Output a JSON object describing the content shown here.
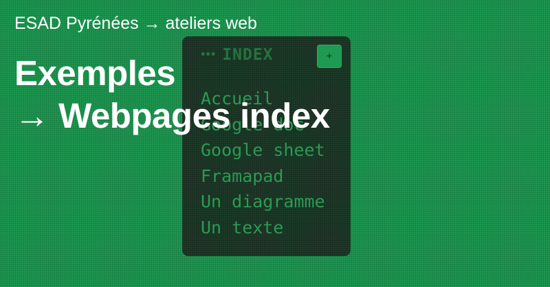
{
  "brand": {
    "label": "ESAD Pyrénées → ateliers web"
  },
  "title": {
    "line1": "Exemples",
    "line2": "→ Webpages index"
  },
  "index_panel": {
    "menu_icon_glyph": "•••",
    "heading": "INDEX",
    "add_button_label": "+",
    "items": [
      "Accueil",
      "Google doc",
      "Google sheet",
      "Framapad",
      "Un diagramme",
      "Un texte"
    ]
  },
  "colors": {
    "background": "#1e9a52",
    "panel": "#1b2e22",
    "panel_text": "#2a9a55",
    "overlay_text": "#ffffff"
  }
}
